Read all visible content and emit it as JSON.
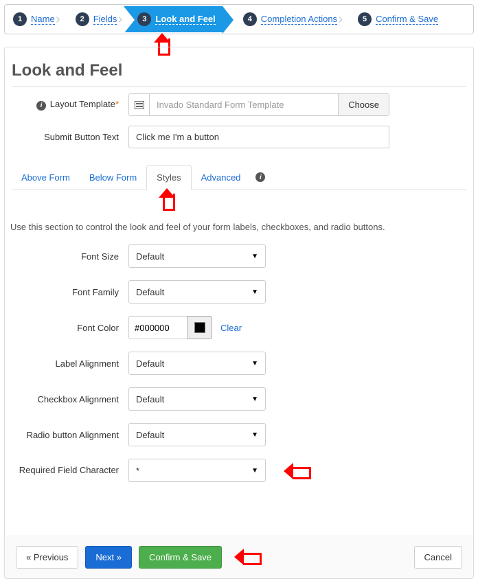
{
  "wizard": {
    "steps": [
      {
        "num": "1",
        "label": "Name"
      },
      {
        "num": "2",
        "label": "Fields"
      },
      {
        "num": "3",
        "label": "Look and Feel"
      },
      {
        "num": "4",
        "label": "Completion Actions"
      },
      {
        "num": "5",
        "label": "Confirm & Save"
      }
    ],
    "active_index": 2
  },
  "page_title": "Look and Feel",
  "fields": {
    "layout_template": {
      "label": "Layout Template",
      "value": "Invado Standard Form Template",
      "choose_label": "Choose"
    },
    "submit_button_text": {
      "label": "Submit Button Text",
      "value": "Click me I'm a button"
    }
  },
  "tabs": {
    "items": [
      "Above Form",
      "Below Form",
      "Styles",
      "Advanced"
    ],
    "active_index": 2
  },
  "section_desc": "Use this section to control the look and feel of your form labels, checkboxes, and radio buttons.",
  "styles": {
    "font_size": {
      "label": "Font Size",
      "value": "Default"
    },
    "font_family": {
      "label": "Font Family",
      "value": "Default"
    },
    "font_color": {
      "label": "Font Color",
      "value": "#000000",
      "clear": "Clear"
    },
    "label_alignment": {
      "label": "Label Alignment",
      "value": "Default"
    },
    "checkbox_alignment": {
      "label": "Checkbox Alignment",
      "value": "Default"
    },
    "radio_alignment": {
      "label": "Radio button Alignment",
      "value": "Default"
    },
    "required_char": {
      "label": "Required Field Character",
      "value": "*"
    }
  },
  "footer": {
    "previous": "« Previous",
    "next": "Next »",
    "confirm": "Confirm & Save",
    "cancel": "Cancel"
  }
}
